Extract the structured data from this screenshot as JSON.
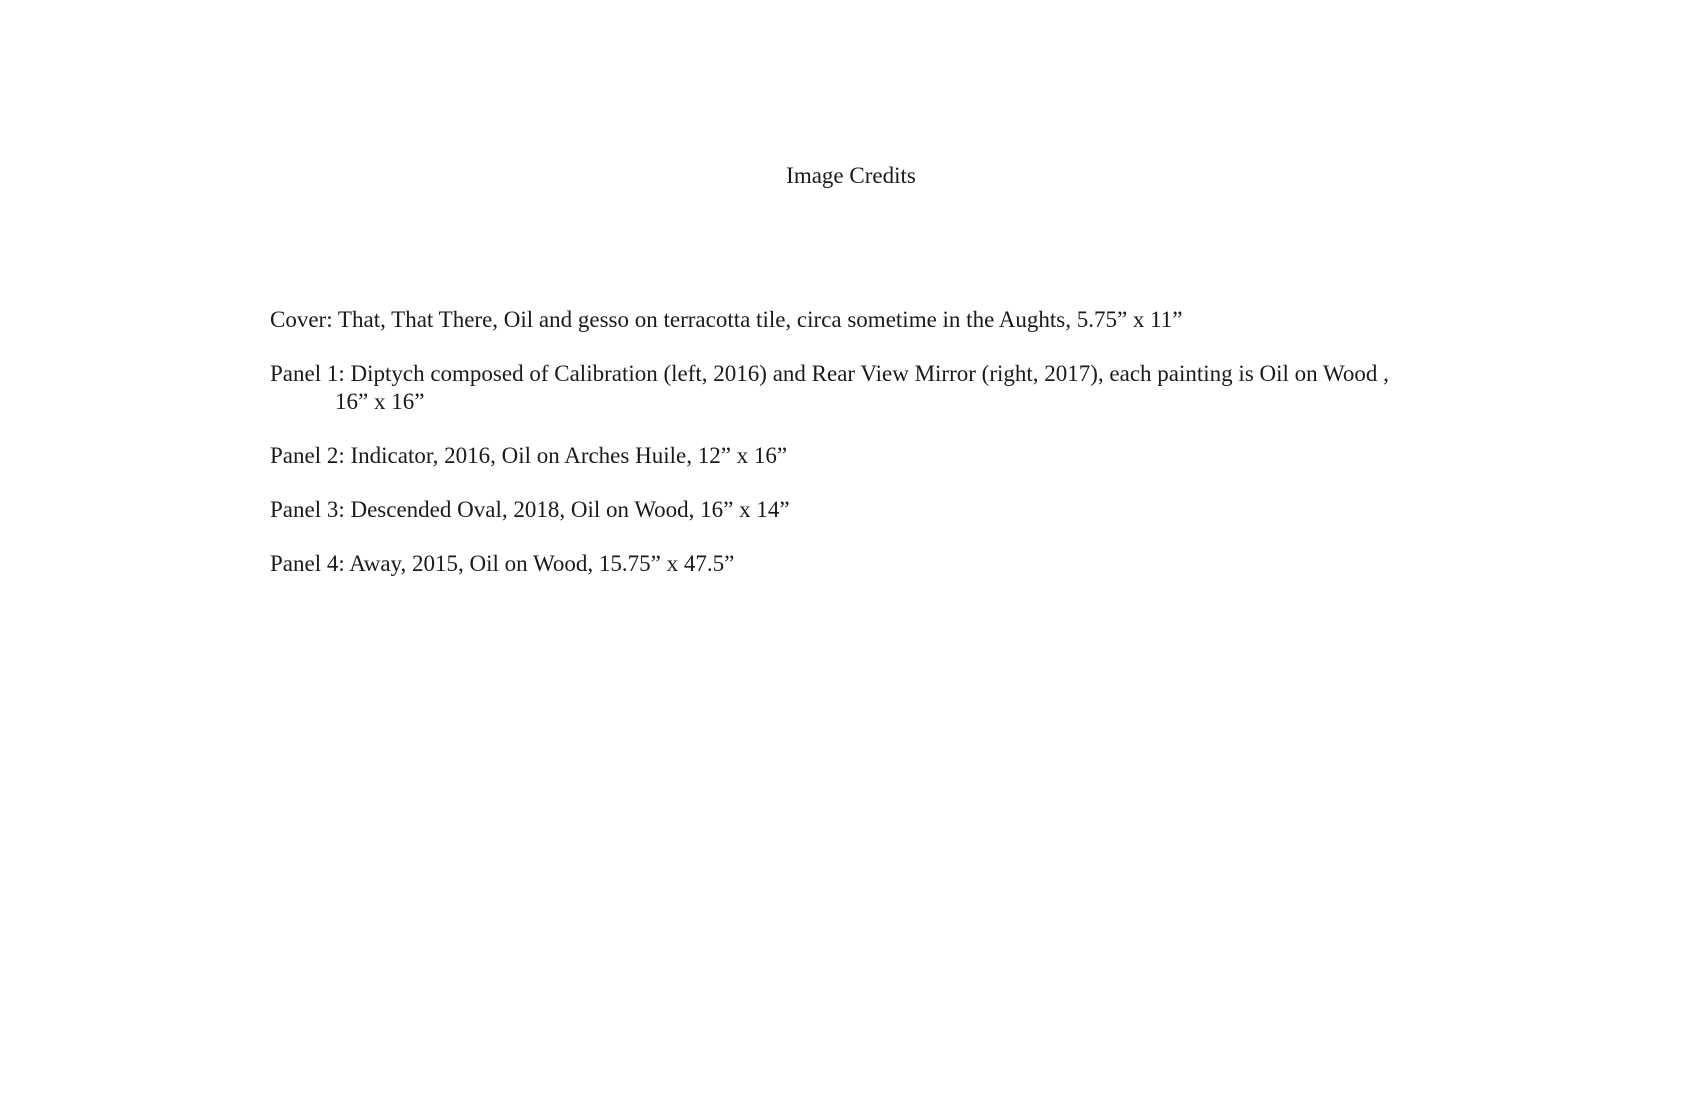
{
  "document": {
    "title": "Image Credits",
    "credits": [
      "Cover: That, That There, Oil and gesso on terracotta tile, circa sometime in the Aughts, 5.75” x 11”",
      "Panel 1: Diptych composed of Calibration (left, 2016) and Rear View Mirror (right, 2017), each painting is Oil on Wood , 16” x 16”",
      "Panel 2: Indicator, 2016, Oil on Arches Huile, 12” x 16”",
      "Panel 3: Descended Oval, 2018, Oil on Wood, 16” x 14”",
      "Panel 4: Away, 2015, Oil on Wood, 15.75” x 47.5”"
    ]
  }
}
